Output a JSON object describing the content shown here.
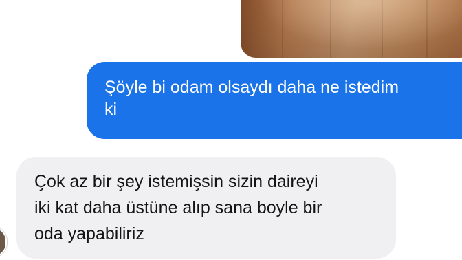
{
  "conversation": {
    "shared_photo": {
      "description_icon": "photo-image"
    },
    "outgoing_message": {
      "lines": [
        "Şöyle bi odam olsaydı daha ne istedim",
        "ki"
      ]
    },
    "incoming_message": {
      "lines": [
        "Çok az bir şey istemişsin sizin daireyi",
        "iki kat daha üstüne alıp sana boyle bir",
        "oda yapabiliriz"
      ]
    }
  },
  "colors": {
    "outgoing_bubble": "#1a73e9",
    "incoming_bubble": "#f0f0f3",
    "background": "#ffffff"
  }
}
